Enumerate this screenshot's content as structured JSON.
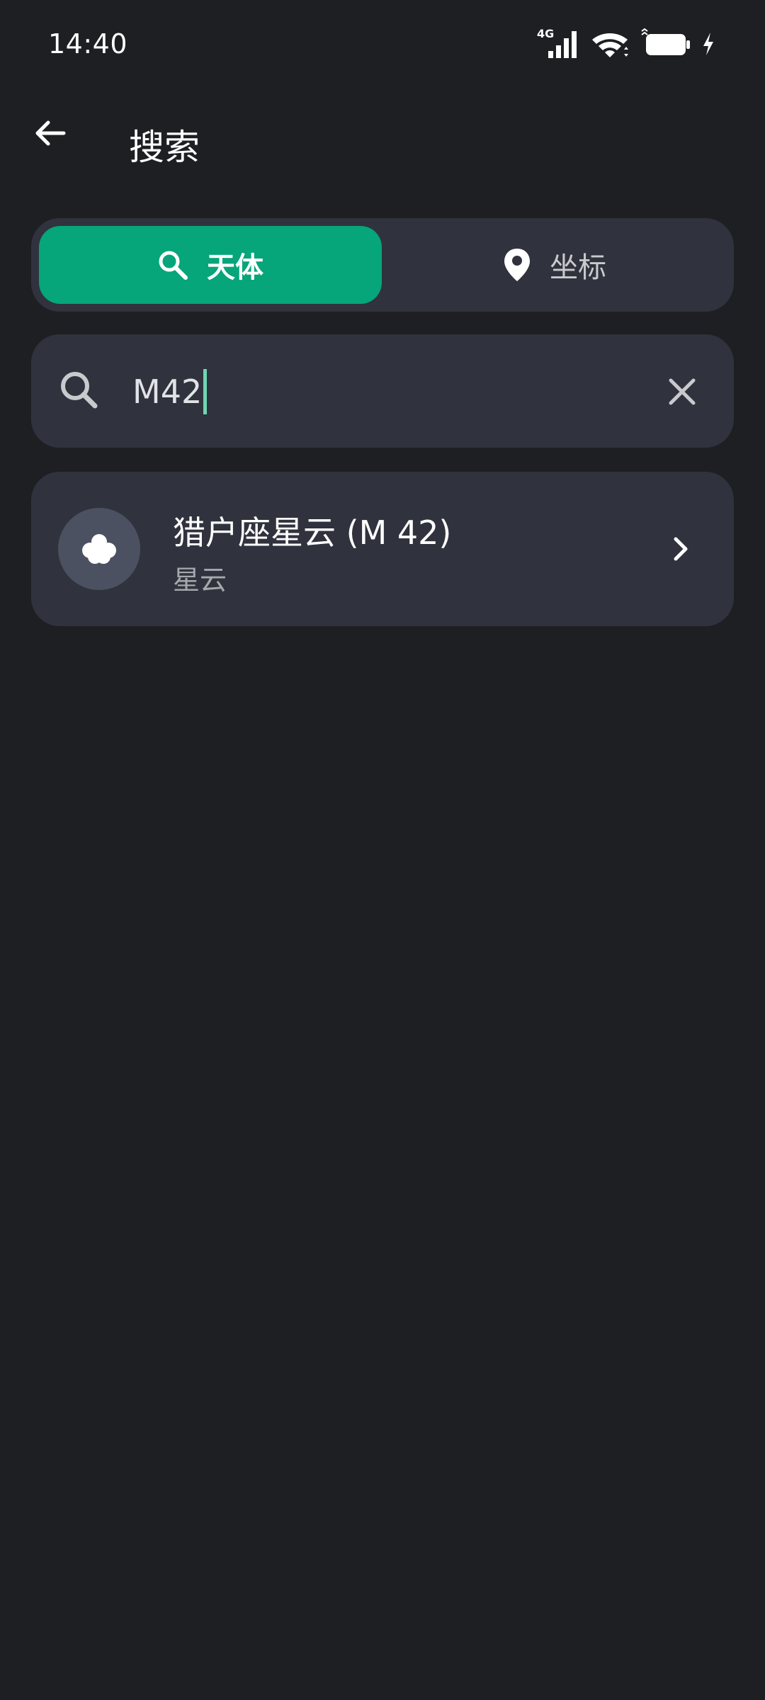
{
  "status_bar": {
    "time": "14:40",
    "network_label": "4G",
    "icons": [
      "4g-signal-icon",
      "wifi-icon",
      "battery-icon",
      "charging-icon"
    ]
  },
  "header": {
    "back_icon": "arrow-left-icon",
    "title": "搜索"
  },
  "tabs": [
    {
      "label": "天体",
      "icon": "search-icon",
      "selected": true
    },
    {
      "label": "坐标",
      "icon": "location-pin-icon",
      "selected": false
    }
  ],
  "search": {
    "value": "M42",
    "icon": "search-icon",
    "clear_icon": "close-icon"
  },
  "results": [
    {
      "title": "猎户座星云 (M 42)",
      "subtitle": "星云",
      "icon": "cloud-icon",
      "chevron": "chevron-right-icon"
    }
  ],
  "colors": {
    "background": "#1e1f23",
    "surface": "#30323d",
    "accent": "#06a57a",
    "caret": "#6fd6b0",
    "avatar_bg": "#4b5160"
  }
}
